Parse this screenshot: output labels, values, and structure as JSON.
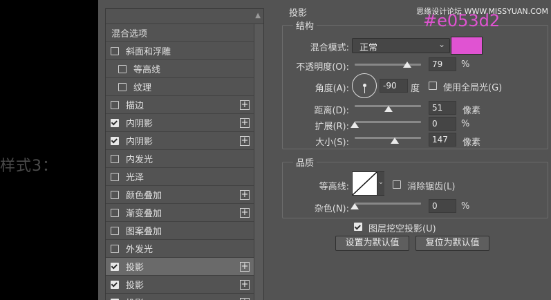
{
  "caption": "样式3：",
  "watermark": "思缘设计论坛 WWW.MISSYUAN.COM",
  "hex_annotation": "#e053d2",
  "colors": {
    "shadow_color": "#e053d2",
    "accent": "#e053d2"
  },
  "list": {
    "header": "混合选项",
    "items": [
      {
        "label": "斜面和浮雕",
        "checked": false,
        "plus": false,
        "sub": false
      },
      {
        "label": "等高线",
        "checked": false,
        "plus": false,
        "sub": true
      },
      {
        "label": "纹理",
        "checked": false,
        "plus": false,
        "sub": true
      },
      {
        "label": "描边",
        "checked": false,
        "plus": true,
        "sub": false
      },
      {
        "label": "内阴影",
        "checked": true,
        "plus": true,
        "sub": false
      },
      {
        "label": "内阴影",
        "checked": true,
        "plus": true,
        "sub": false
      },
      {
        "label": "内发光",
        "checked": false,
        "plus": false,
        "sub": false
      },
      {
        "label": "光泽",
        "checked": false,
        "plus": false,
        "sub": false
      },
      {
        "label": "颜色叠加",
        "checked": false,
        "plus": true,
        "sub": false
      },
      {
        "label": "渐变叠加",
        "checked": false,
        "plus": true,
        "sub": false
      },
      {
        "label": "图案叠加",
        "checked": false,
        "plus": false,
        "sub": false
      },
      {
        "label": "外发光",
        "checked": false,
        "plus": false,
        "sub": false
      },
      {
        "label": "投影",
        "checked": true,
        "plus": true,
        "sub": false,
        "selected": true
      },
      {
        "label": "投影",
        "checked": true,
        "plus": true,
        "sub": false
      },
      {
        "label": "投影",
        "checked": true,
        "plus": true,
        "sub": false
      }
    ]
  },
  "panel": {
    "title": "投影",
    "structure": {
      "title": "结构",
      "blend_mode_label": "混合模式:",
      "blend_mode_value": "正常",
      "opacity_label": "不透明度(O):",
      "opacity_value": "79",
      "opacity_unit": "%",
      "opacity_level": 79,
      "angle_label": "角度(A):",
      "angle_value": "-90",
      "angle_unit": "度",
      "global_light_label": "使用全局光(G)",
      "global_light_checked": false,
      "distance_label": "距离(D):",
      "distance_value": "51",
      "distance_unit": "像素",
      "distance_level": 0.51,
      "spread_label": "扩展(R):",
      "spread_value": "0",
      "spread_unit": "%",
      "spread_level": 0,
      "size_label": "大小(S):",
      "size_value": "147",
      "size_unit": "像素",
      "size_level": 0.6
    },
    "quality": {
      "title": "品质",
      "contour_label": "等高线:",
      "anti_alias_label": "消除锯齿(L)",
      "anti_alias_checked": false,
      "noise_label": "杂色(N):",
      "noise_value": "0",
      "noise_unit": "%",
      "noise_level": 0
    },
    "knockout_label": "图层挖空投影(U)",
    "knockout_checked": true,
    "set_default_label": "设置为默认值",
    "reset_default_label": "复位为默认值"
  }
}
